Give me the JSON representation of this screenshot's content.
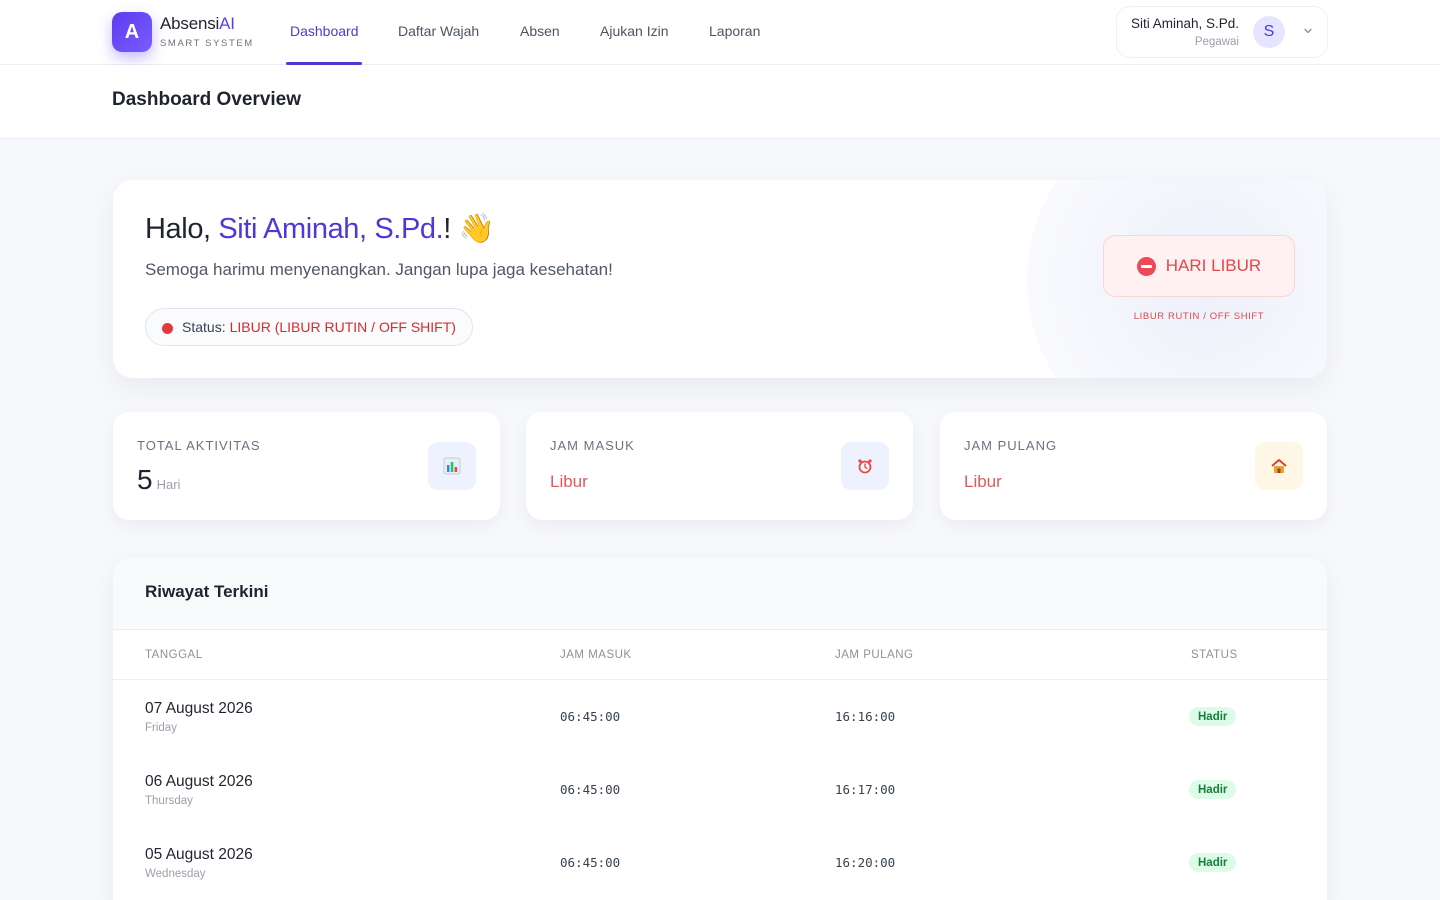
{
  "brand": {
    "logo_letter": "A",
    "name_main": "Absensi",
    "name_accent": "AI",
    "tagline": "SMART SYSTEM"
  },
  "nav": {
    "items": [
      {
        "label": "Dashboard",
        "active": true
      },
      {
        "label": "Daftar Wajah"
      },
      {
        "label": "Absen"
      },
      {
        "label": "Ajukan Izin"
      },
      {
        "label": "Laporan"
      }
    ]
  },
  "user": {
    "name": "Siti Aminah, S.Pd.",
    "role": "Pegawai",
    "initial": "S"
  },
  "page": {
    "title": "Dashboard Overview"
  },
  "greeting": {
    "hello": "Halo, ",
    "name": "Siti Aminah, S.Pd.",
    "suffix": "! 👋",
    "subtitle": "Semoga harimu menyenangkan. Jangan lupa jaga kesehatan!",
    "status_label": "Status:",
    "status_value": "LIBUR (LIBUR RUTIN / OFF SHIFT)",
    "badge": "HARI LIBUR",
    "badge_caption": "LIBUR RUTIN / OFF SHIFT"
  },
  "stats": [
    {
      "label": "TOTAL AKTIVITAS",
      "value": "5",
      "unit": "Hari",
      "icon": "bar-chart-icon"
    },
    {
      "label": "JAM MASUK",
      "value": "Libur",
      "icon": "alarm-clock-icon"
    },
    {
      "label": "JAM PULANG",
      "value": "Libur",
      "icon": "house-icon"
    }
  ],
  "history": {
    "title": "Riwayat Terkini",
    "columns": [
      "TANGGAL",
      "JAM MASUK",
      "JAM PULANG",
      "STATUS"
    ],
    "rows": [
      {
        "date": "07 August 2026",
        "day": "Friday",
        "in": "06:45:00",
        "out": "16:16:00",
        "status": "Hadir"
      },
      {
        "date": "06 August 2026",
        "day": "Thursday",
        "in": "06:45:00",
        "out": "16:17:00",
        "status": "Hadir"
      },
      {
        "date": "05 August 2026",
        "day": "Wednesday",
        "in": "06:45:00",
        "out": "16:20:00",
        "status": "Hadir"
      }
    ]
  },
  "colors": {
    "accent": "#4f39d6",
    "danger": "#e1474b",
    "success_bg": "#dcfce7",
    "success_text": "#15803d"
  }
}
